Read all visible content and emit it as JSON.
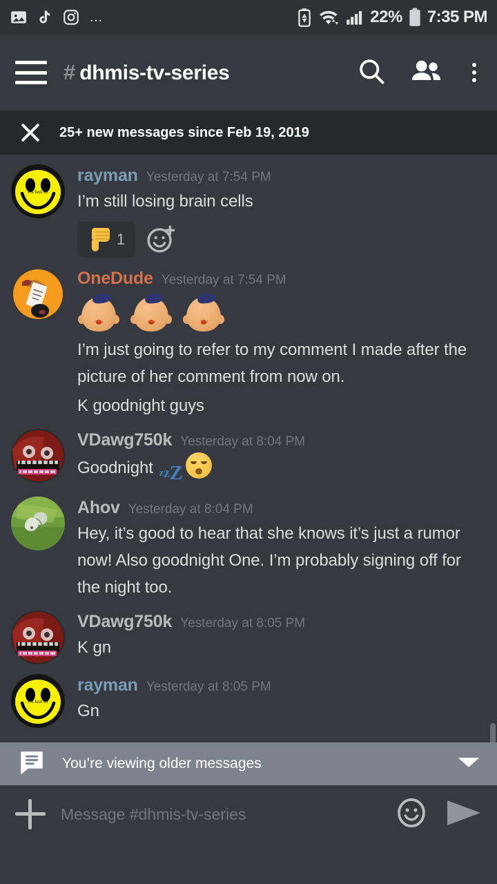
{
  "status_bar": {
    "left_icons": [
      "gallery-icon",
      "tiktok-icon",
      "instagram-icon",
      "more-notifications-icon"
    ],
    "more_glyph": "…",
    "right_icons": [
      "battery-saver-icon",
      "wifi-icon",
      "cellular-signal-icon"
    ],
    "battery_percent": "22%",
    "time": "7:35 PM"
  },
  "header": {
    "menu_icon": "hamburger-menu-icon",
    "hash": "#",
    "channel_name": "dhmis-tv-series",
    "search_icon": "search-icon",
    "members_icon": "members-icon",
    "overflow_icon": "overflow-menu-icon"
  },
  "new_messages_bar": {
    "close_icon": "close-icon",
    "text": "25+ new messages since Feb 19, 2019"
  },
  "messages": [
    {
      "author": "rayman",
      "author_color": "#7a9cb5",
      "timestamp": "Yesterday at 7:54 PM",
      "avatar": "smiley-face-avatar",
      "avatar_caption": "Pls fuck off",
      "lines": [
        "I’m still losing brain cells"
      ],
      "reactions": [
        {
          "emoji": "thumbs-down",
          "count": "1"
        }
      ],
      "add_reaction_icon": "add-reaction-icon"
    },
    {
      "author": "OneDude",
      "author_color": "#d2714b",
      "timestamp": "Yesterday at 7:54 PM",
      "avatar": "hand-holding-paper-avatar",
      "custom_emoji": {
        "name": "dhmis-puppet-head",
        "count": 3
      },
      "lines": [
        "I’m just going to refer to my comment I made after the picture of her comment from now on.",
        "K goodnight guys"
      ]
    },
    {
      "author": "VDawg750k",
      "author_color": "#b9bbbe",
      "timestamp": "Yesterday at 8:04 PM",
      "avatar": "red-monster-avatar",
      "lines": [
        "Goodnight "
      ],
      "trailing_emoji": [
        "zzz-emoji",
        "sleeping-face-emoji"
      ]
    },
    {
      "author": "Ahov",
      "author_color": "#b9bbbe",
      "timestamp": "Yesterday at 8:04 PM",
      "avatar": "butterfly-photo-avatar",
      "lines": [
        "Hey, it’s good to hear that she knows it’s just a rumor now! Also goodnight One. I’m probably signing off for the night too."
      ]
    },
    {
      "author": "VDawg750k",
      "author_color": "#b9bbbe",
      "timestamp": "Yesterday at 8:05 PM",
      "avatar": "red-monster-avatar",
      "lines": [
        "K gn"
      ]
    },
    {
      "author": "rayman",
      "author_color": "#7a9cb5",
      "timestamp": "Yesterday at 8:05 PM",
      "avatar": "smiley-face-avatar",
      "avatar_caption": "Pls fuck off",
      "lines": [
        "Gn"
      ]
    }
  ],
  "jump_bar": {
    "icon": "chat-bubble-icon",
    "text": "You’re viewing older messages",
    "chevron": "chevron-down-icon"
  },
  "composer": {
    "add_icon": "plus-icon",
    "placeholder": "Message #dhmis-tv-series",
    "value": "",
    "emoji_icon": "emoji-picker-icon",
    "send_icon": "send-icon"
  },
  "colors": {
    "chat_background": "#36393f",
    "header_background": "#36393f",
    "status_bar_background": "#2f3136",
    "new_bar_background": "#26282c",
    "jump_bar_background": "#7d848e",
    "scrollbar": "#6a6d75"
  }
}
